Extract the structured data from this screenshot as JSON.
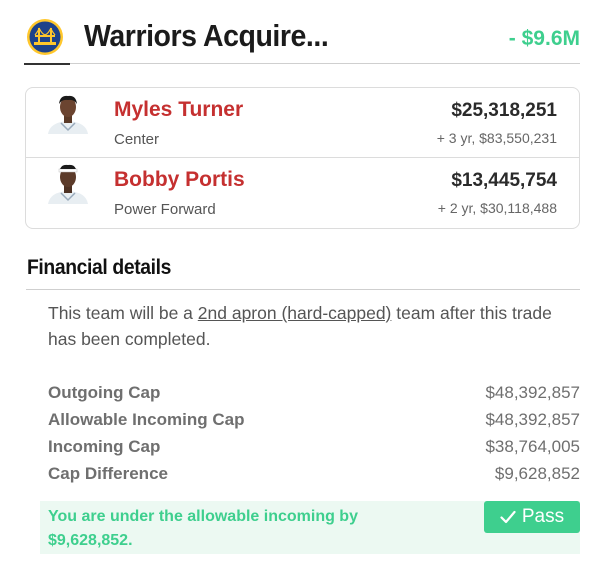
{
  "header": {
    "title": "Warriors Acquire...",
    "net_change": "- $9.6M"
  },
  "players": [
    {
      "name": "Myles Turner",
      "position": "Center",
      "salary": "$25,318,251",
      "extension": "+ 3 yr, $83,550,231"
    },
    {
      "name": "Bobby Portis",
      "position": "Power Forward",
      "salary": "$13,445,754",
      "extension": "+ 2 yr, $30,118,488"
    }
  ],
  "financial": {
    "title": "Financial details",
    "note_prefix": "This team will be a ",
    "note_link": "2nd apron (hard-capped)",
    "note_suffix": " team after this trade has been completed.",
    "rows": [
      {
        "label": "Outgoing Cap",
        "value": "$48,392,857"
      },
      {
        "label": "Allowable Incoming Cap",
        "value": "$48,392,857"
      },
      {
        "label": "Incoming Cap",
        "value": "$38,764,005"
      },
      {
        "label": "Cap Difference",
        "value": "$9,628,852"
      }
    ],
    "result_text": "You are under the allowable incoming by $9,628,852.",
    "status": "Pass"
  },
  "colors": {
    "accent_green": "#3ecf8e",
    "player_name_red": "#c53030",
    "warriors_blue": "#1d428a",
    "warriors_gold": "#ffc72c"
  },
  "icons": {
    "team_logo": "warriors-logo",
    "pass": "check-icon"
  }
}
